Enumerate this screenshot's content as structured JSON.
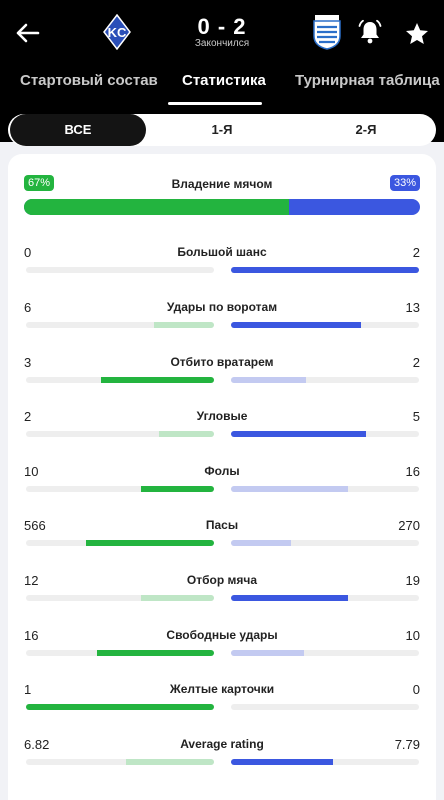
{
  "header": {
    "score": "0 - 2",
    "status": "Закончился",
    "icons": {
      "back": "arrow-left-icon",
      "home_crest": "krylia-sovetov-crest",
      "away_crest": "away-team-crest",
      "bell": "bell-icon",
      "star": "star-icon"
    }
  },
  "tabs": [
    {
      "label": "Стартовый состав"
    },
    {
      "label": "Статистика",
      "active": true
    },
    {
      "label": "Турнирная таблица"
    }
  ],
  "periods": [
    {
      "label": "ВСЕ",
      "active": true
    },
    {
      "label": "1-Я"
    },
    {
      "label": "2-Я"
    }
  ],
  "possession": {
    "label": "Владение мячом",
    "home_pct": "67%",
    "away_pct": "33%",
    "home_fraction": 0.67
  },
  "stats": [
    {
      "label": "Большой шанс",
      "home": "0",
      "away": "2",
      "home_fill": 0.0,
      "away_fill": 1.0,
      "leader": "away"
    },
    {
      "label": "Удары по воротам",
      "home": "6",
      "away": "13",
      "home_fill": 0.32,
      "away_fill": 0.69,
      "leader": "away"
    },
    {
      "label": "Отбито вратарем",
      "home": "3",
      "away": "2",
      "home_fill": 0.6,
      "away_fill": 0.4,
      "leader": "home"
    },
    {
      "label": "Угловые",
      "home": "2",
      "away": "5",
      "home_fill": 0.29,
      "away_fill": 0.72,
      "leader": "away"
    },
    {
      "label": "Фолы",
      "home": "10",
      "away": "16",
      "home_fill": 0.39,
      "away_fill": 0.62,
      "leader": "home"
    },
    {
      "label": "Пасы",
      "home": "566",
      "away": "270",
      "home_fill": 0.68,
      "away_fill": 0.32,
      "leader": "home"
    },
    {
      "label": "Отбор мяча",
      "home": "12",
      "away": "19",
      "home_fill": 0.39,
      "away_fill": 0.62,
      "leader": "away"
    },
    {
      "label": "Свободные удары",
      "home": "16",
      "away": "10",
      "home_fill": 0.62,
      "away_fill": 0.39,
      "leader": "home"
    },
    {
      "label": "Желтые карточки",
      "home": "1",
      "away": "0",
      "home_fill": 1.0,
      "away_fill": 0.0,
      "leader": "home"
    },
    {
      "label": "Average rating",
      "home": "6.82",
      "away": "7.79",
      "home_fill": 0.47,
      "away_fill": 0.54,
      "leader": "away"
    }
  ],
  "colors": {
    "home_strong": "#23b43f",
    "home_light": "#bfe6c6",
    "away_strong": "#3b57e0",
    "away_light": "#c3caf1",
    "track": "#eeeeee"
  }
}
